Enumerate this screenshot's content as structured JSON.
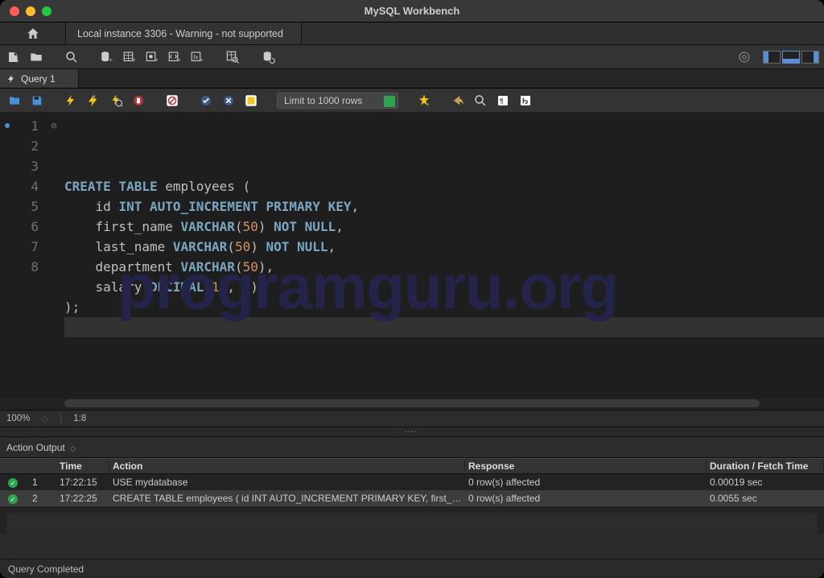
{
  "app_title": "MySQL Workbench",
  "connection_tab": "Local instance 3306 - Warning - not supported",
  "query_tab_label": "Query 1",
  "limit_label": "Limit to 1000 rows",
  "zoom": "100%",
  "cursor_pos": "1:8",
  "output_dropdown": "Action Output",
  "grid": {
    "headers": {
      "time": "Time",
      "action": "Action",
      "response": "Response",
      "duration": "Duration / Fetch Time"
    },
    "rows": [
      {
        "idx": "1",
        "time": "17:22:15",
        "action": "USE mydatabase",
        "response": "0 row(s) affected",
        "duration": "0.00019 sec"
      },
      {
        "idx": "2",
        "time": "17:22:25",
        "action": "CREATE TABLE employees (     id INT AUTO_INCREMENT PRIMARY KEY,     first_n…",
        "response": "0 row(s) affected",
        "duration": "0.0055 sec"
      }
    ]
  },
  "status_text": "Query Completed",
  "watermark": "programguru.org",
  "code": {
    "lines": [
      [
        {
          "t": "CREATE",
          "c": "kw"
        },
        {
          "t": " "
        },
        {
          "t": "TABLE",
          "c": "kw"
        },
        {
          "t": " employees ("
        }
      ],
      [
        {
          "t": "    id "
        },
        {
          "t": "INT",
          "c": "type"
        },
        {
          "t": " "
        },
        {
          "t": "AUTO_INCREMENT",
          "c": "type"
        },
        {
          "t": " "
        },
        {
          "t": "PRIMARY",
          "c": "type"
        },
        {
          "t": " "
        },
        {
          "t": "KEY",
          "c": "type"
        },
        {
          "t": ","
        }
      ],
      [
        {
          "t": "    first_name "
        },
        {
          "t": "VARCHAR",
          "c": "type"
        },
        {
          "t": "("
        },
        {
          "t": "50",
          "c": "num"
        },
        {
          "t": ") "
        },
        {
          "t": "NOT",
          "c": "type"
        },
        {
          "t": " "
        },
        {
          "t": "NULL",
          "c": "type"
        },
        {
          "t": ","
        }
      ],
      [
        {
          "t": "    last_name "
        },
        {
          "t": "VARCHAR",
          "c": "type"
        },
        {
          "t": "("
        },
        {
          "t": "50",
          "c": "num"
        },
        {
          "t": ") "
        },
        {
          "t": "NOT",
          "c": "type"
        },
        {
          "t": " "
        },
        {
          "t": "NULL",
          "c": "type"
        },
        {
          "t": ","
        }
      ],
      [
        {
          "t": "    department "
        },
        {
          "t": "VARCHAR",
          "c": "type"
        },
        {
          "t": "("
        },
        {
          "t": "50",
          "c": "num"
        },
        {
          "t": "),"
        }
      ],
      [
        {
          "t": "    salary "
        },
        {
          "t": "DECIMAL",
          "c": "type"
        },
        {
          "t": "("
        },
        {
          "t": "10",
          "c": "num"
        },
        {
          "t": ", "
        },
        {
          "t": "2",
          "c": "num"
        },
        {
          "t": ")"
        }
      ],
      [
        {
          "t": ");"
        }
      ],
      [
        {
          "t": ""
        }
      ]
    ]
  }
}
